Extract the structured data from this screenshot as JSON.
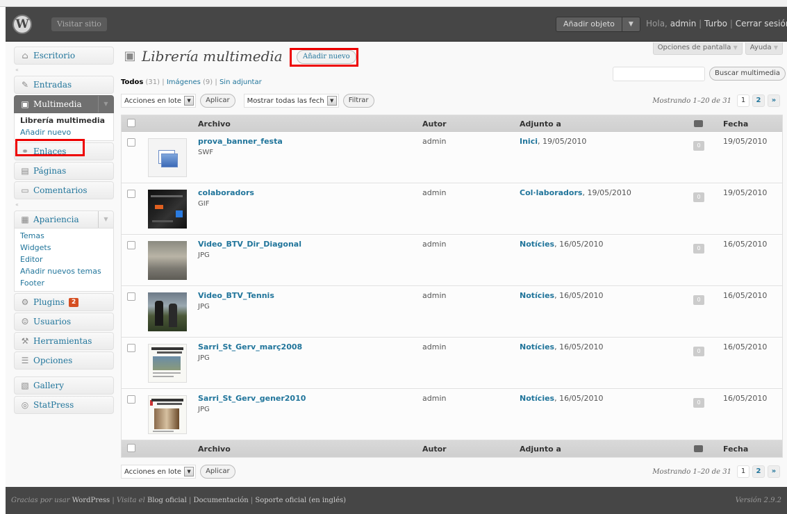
{
  "header": {
    "visit_site": "Visitar sitio",
    "add_object": "Añadir objeto",
    "greeting_prefix": "Hola,",
    "user": "admin",
    "turbo": "Turbo",
    "logout": "Cerrar sesión"
  },
  "screen_meta": {
    "screen_options": "Opciones de pantalla",
    "help": "Ayuda"
  },
  "sidebar": {
    "dashboard": "Escritorio",
    "posts": "Entradas",
    "media": "Multimedia",
    "media_sub": [
      "Librería multimedia",
      "Añadir nuevo"
    ],
    "links": "Enlaces",
    "pages": "Páginas",
    "comments": "Comentarios",
    "appearance": "Apariencia",
    "appearance_sub": [
      "Temas",
      "Widgets",
      "Editor",
      "Añadir nuevos temas",
      "Footer"
    ],
    "plugins": "Plugins",
    "plugins_badge": "2",
    "users": "Usuarios",
    "tools": "Herramientas",
    "settings": "Opciones",
    "gallery": "Gallery",
    "statpress": "StatPress"
  },
  "page": {
    "title": "Librería multimedia",
    "add_new": "Añadir nuevo"
  },
  "filters": {
    "all": "Todos",
    "all_count": "(31)",
    "images": "Imágenes",
    "images_count": "(9)",
    "unattached": "Sin adjuntar"
  },
  "search": {
    "value": "",
    "button": "Buscar multimedia"
  },
  "tablenav": {
    "bulk_actions": "Acciones en lote",
    "apply": "Aplicar",
    "dates": "Mostrar todas las fech",
    "filter": "Filtrar",
    "displaying": "Mostrando 1–20 de 31",
    "page1": "1",
    "page2": "2",
    "next": "»"
  },
  "table": {
    "columns": [
      "Archivo",
      "Autor",
      "Adjunto a",
      "Fecha"
    ],
    "rows": [
      {
        "file": "prova_banner_festa",
        "ext": "SWF",
        "author": "admin",
        "parent": "Inici",
        "parent_date": ", 19/05/2010",
        "comments": "0",
        "date": "19/05/2010"
      },
      {
        "file": "colaboradors",
        "ext": "GIF",
        "author": "admin",
        "parent": "Col·laboradors",
        "parent_date": ", 19/05/2010",
        "comments": "0",
        "date": "19/05/2010"
      },
      {
        "file": "Video_BTV_Dir_Diagonal",
        "ext": "JPG",
        "author": "admin",
        "parent": "Notícies",
        "parent_date": ", 16/05/2010",
        "comments": "0",
        "date": "16/05/2010"
      },
      {
        "file": "Video_BTV_Tennis",
        "ext": "JPG",
        "author": "admin",
        "parent": "Notícies",
        "parent_date": ", 16/05/2010",
        "comments": "0",
        "date": "16/05/2010"
      },
      {
        "file": "Sarri_St_Gerv_març2008",
        "ext": "JPG",
        "author": "admin",
        "parent": "Notícies",
        "parent_date": ", 16/05/2010",
        "comments": "0",
        "date": "16/05/2010"
      },
      {
        "file": "Sarri_St_Gerv_gener2010",
        "ext": "JPG",
        "author": "admin",
        "parent": "Notícies",
        "parent_date": ", 16/05/2010",
        "comments": "0",
        "date": "16/05/2010"
      }
    ]
  },
  "footer": {
    "thanks": "Gracias por usar",
    "wordpress": "WordPress",
    "visit": "Visita el",
    "blog": "Blog oficial",
    "docs": "Documentación",
    "support": "Soporte oficial (en inglés)",
    "version": "Versión 2.9.2"
  },
  "colors": {
    "header_bg": "#464646",
    "link": "#21759b",
    "highlight": "#e00000",
    "badge": "#d54e21"
  }
}
